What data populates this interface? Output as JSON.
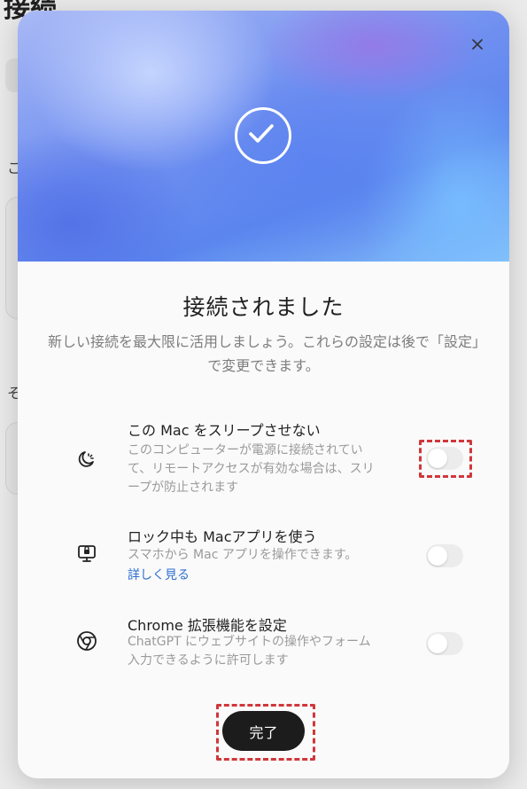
{
  "background": {
    "page_title": "接続",
    "section_label_1": "こ",
    "section_label_2": "そ"
  },
  "modal": {
    "close_label": "×",
    "title": "接続されました",
    "subtitle": "新しい接続を最大限に活用しましょう。これらの設定は後で「設定」で変更できます。",
    "settings": [
      {
        "icon": "sleep-moon-icon",
        "title": "この Mac をスリープさせない",
        "description_lines": [
          "このコンピューターが電源に接続されてい",
          "て、リモートアクセスが有効な場合は、スリ",
          "ープが防止されます"
        ],
        "enabled": false
      },
      {
        "icon": "computer-lock-icon",
        "title": "ロック中も Macアプリを使う",
        "description_lines": [
          "スマホから Mac アプリを操作できます。"
        ],
        "link": "詳しく見る",
        "enabled": false
      },
      {
        "icon": "chrome-icon",
        "title": "Chrome 拡張機能を設定",
        "description_lines": [
          "ChatGPT にウェブサイトの操作やフォーム",
          "入力できるように許可します"
        ],
        "enabled": false
      }
    ],
    "done_label": "完了"
  },
  "colors": {
    "highlight": "#d0373a",
    "done_button": "#1c1c1c",
    "link": "#2f6fd0"
  }
}
